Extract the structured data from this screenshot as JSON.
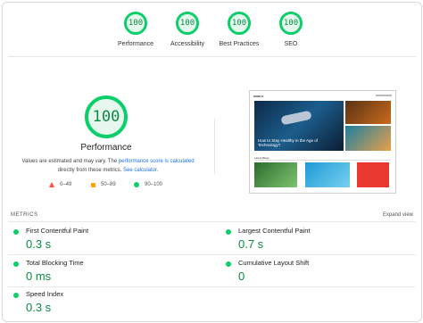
{
  "summary": {
    "gauges": [
      {
        "score": "100",
        "label": "Performance"
      },
      {
        "score": "100",
        "label": "Accessibility"
      },
      {
        "score": "100",
        "label": "Best Practices"
      },
      {
        "score": "100",
        "label": "SEO"
      }
    ]
  },
  "performance": {
    "score": "100",
    "title": "Performance",
    "disclaimer_prefix": "Values are estimated and may vary. The ",
    "score_link": "performance score is calculated",
    "disclaimer_middle": " directly from these metrics. ",
    "calc_link": "See calculator."
  },
  "legend": {
    "fail": "0–49",
    "average": "50–89",
    "pass": "90–100"
  },
  "thumbnail": {
    "site_name": "WORLD",
    "headline": "How to Stay Healthy in the Age of Technology?",
    "section": "Latest Blogs"
  },
  "metrics": {
    "heading": "METRICS",
    "expand_label": "Expand view",
    "items": [
      {
        "label": "First Contentful Paint",
        "value": "0.3 s"
      },
      {
        "label": "Largest Contentful Paint",
        "value": "0.7 s"
      },
      {
        "label": "Total Blocking Time",
        "value": "0 ms"
      },
      {
        "label": "Cumulative Layout Shift",
        "value": "0"
      },
      {
        "label": "Speed Index",
        "value": "0.3 s"
      }
    ]
  },
  "colors": {
    "pass": "#0cce6b",
    "pass_text": "#0a8a45",
    "average": "#ffa400",
    "fail": "#ff4e42",
    "link": "#1a73e8"
  }
}
